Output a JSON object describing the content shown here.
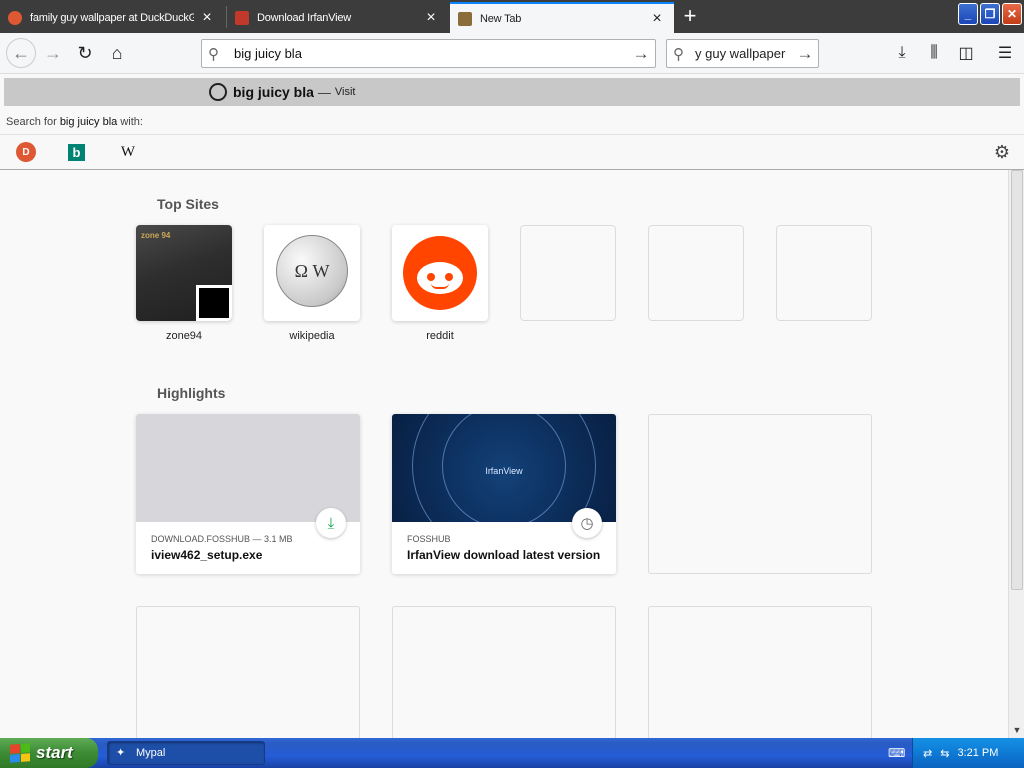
{
  "browser": {
    "tabs": [
      {
        "title": "family guy wallpaper at DuckDuckGo",
        "favicon_color": "#de5833"
      },
      {
        "title": "Download IrfanView",
        "favicon_color": "#c0392b"
      },
      {
        "title": "New Tab",
        "favicon_color": "#8a6d3b"
      }
    ],
    "new_tab_label": "+",
    "url_value": "big juicy bla",
    "search_value": "y guy wallpaper"
  },
  "popup": {
    "suggestion_term": "big juicy bla",
    "suggestion_dash": "—",
    "suggestion_action": "Visit",
    "search_for_prefix": "Search for",
    "search_for_term": "big juicy bla",
    "search_for_suffix": "with:",
    "engines": [
      "DuckDuckGo",
      "Bing",
      "Wikipedia"
    ],
    "engine_glyphs": {
      "ddg": "D",
      "bing": "b",
      "wiki": "W"
    }
  },
  "newtab": {
    "top_sites_title": "Top Sites",
    "top_sites": [
      {
        "label": "zone94",
        "overlay": "zone 94"
      },
      {
        "label": "wikipedia",
        "overlay": "Ω W"
      },
      {
        "label": "reddit"
      }
    ],
    "highlights_title": "Highlights",
    "highlights": [
      {
        "meta": "DOWNLOAD.FOSSHUB — 3.1 MB",
        "title": "iview462_setup.exe",
        "badge": "download-icon"
      },
      {
        "meta": "FOSSHUB",
        "title": "IrfanView download latest version",
        "thumb_text": "IrfanView",
        "badge": "clock-icon"
      }
    ]
  },
  "taskbar": {
    "start_label": "start",
    "task_label": "Mypal",
    "clock": "3:21 PM"
  },
  "colors": {
    "accent": "#0a84ff",
    "reddit": "#ff4500",
    "download_green": "#12a34b"
  }
}
